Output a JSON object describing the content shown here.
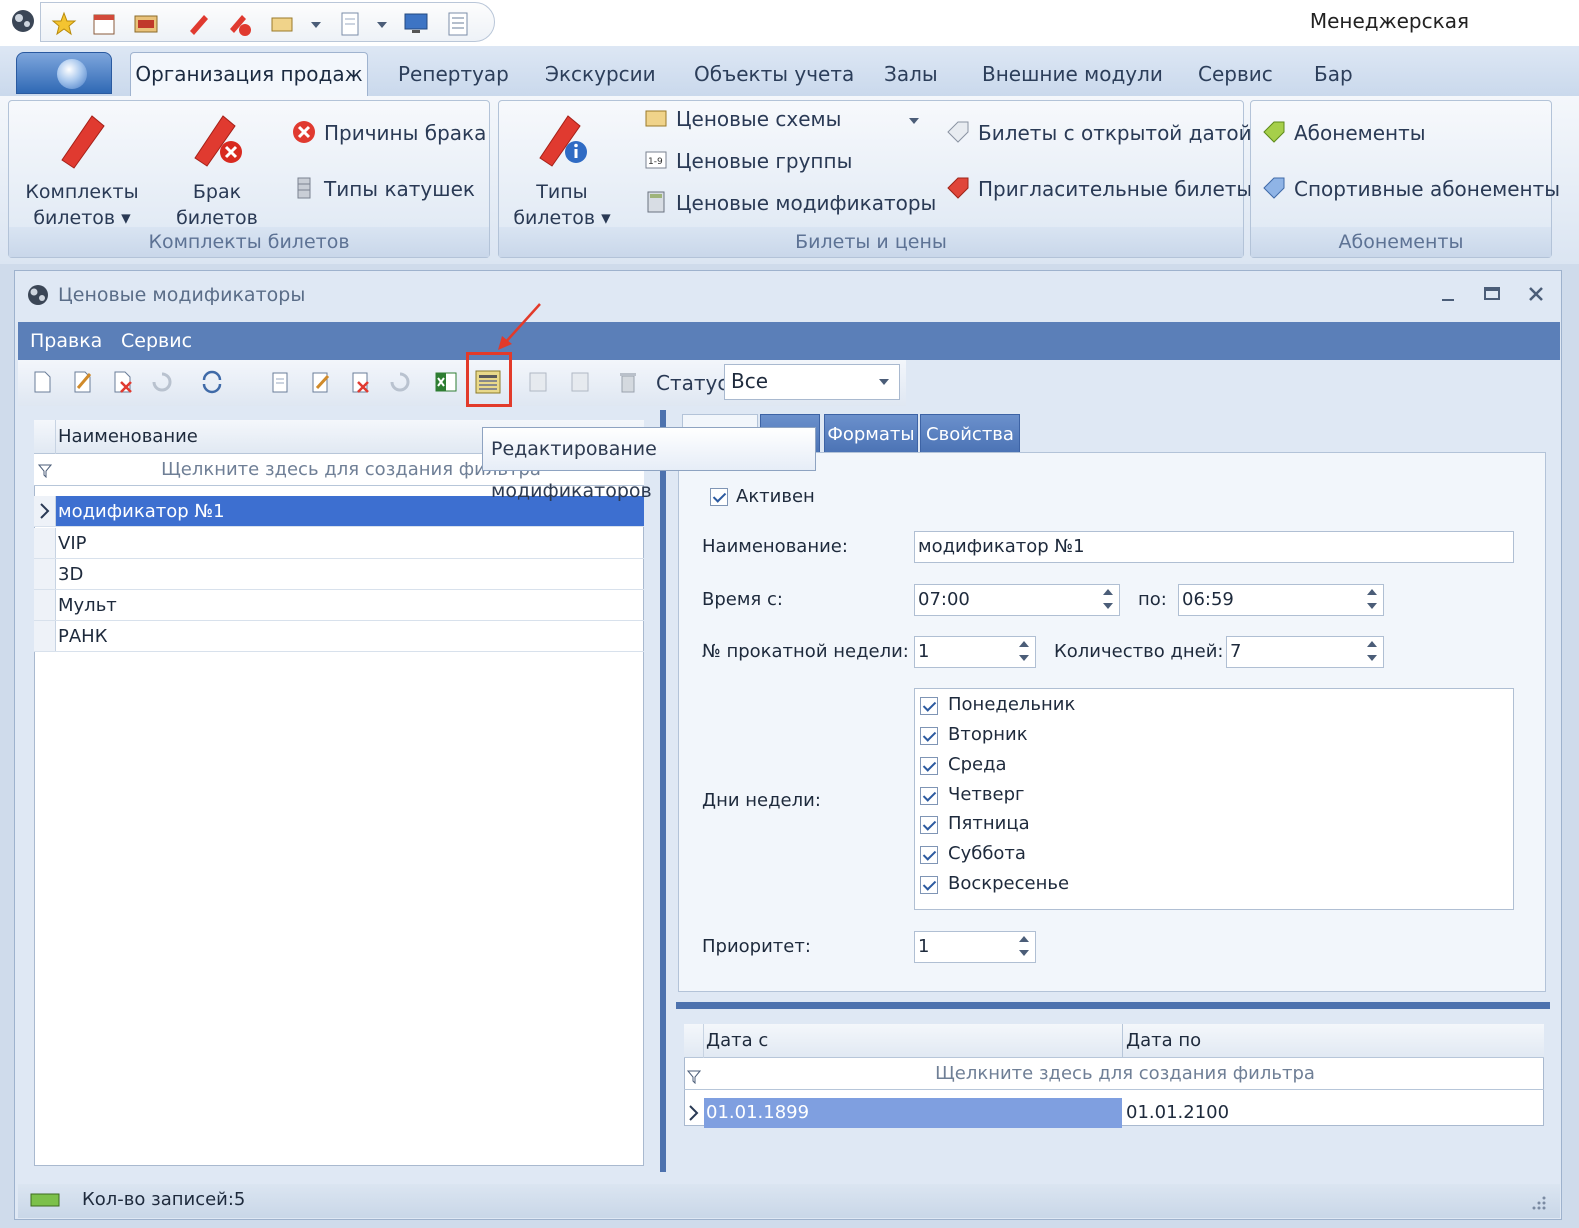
{
  "app_title": "Менеджерская",
  "ribbon_tabs": [
    "Организация продаж",
    "Репертуар",
    "Экскурсии",
    "Объекты учета",
    "Залы",
    "Внешние модули",
    "Сервис",
    "Бар"
  ],
  "groups": {
    "komplekty": {
      "label": "Комплекты билетов",
      "btn1": [
        "Комплекты",
        "билетов ▾"
      ],
      "btn2": [
        "Брак",
        "билетов"
      ],
      "small1": "Причины брака",
      "small2": "Типы катушек"
    },
    "bilety": {
      "label": "Билеты и цены",
      "btn1": [
        "Типы",
        "билетов ▾"
      ],
      "small1": "Ценовые схемы",
      "small2": "Ценовые группы",
      "small3": "Ценовые модификаторы",
      "small4": "Билеты с открытой датой",
      "small5": "Пригласительные билеты"
    },
    "abonementy": {
      "label": "Абонементы",
      "small1": "Абонементы",
      "small2": "Спортивные абонементы"
    }
  },
  "window": {
    "title": "Ценовые модификаторы",
    "menu": [
      "Правка",
      "Сервис"
    ],
    "status_label": "Статус",
    "status_value": "Все",
    "tooltip": "Редактирование модификаторов"
  },
  "list": {
    "header": "Наименование",
    "filter_hint": "Щелкните здесь для создания фильтра",
    "rows": [
      "модификатор №1",
      "VIP",
      "3D",
      "Мульт",
      "РАНК"
    ],
    "selected_index": 0
  },
  "tabs": [
    "Форматы",
    "Свойства"
  ],
  "form": {
    "active_label": "Активен",
    "name_label": "Наименование:",
    "name_value": "модификатор №1",
    "time_from_label": "Время с:",
    "time_from": "07:00",
    "time_to_label": "по:",
    "time_to": "06:59",
    "week_label": "№ прокатной недели:",
    "week_value": "1",
    "days_count_label": "Количество дней:",
    "days_count_value": "7",
    "weekdays_label": "Дни недели:",
    "weekdays": [
      "Понедельник",
      "Вторник",
      "Среда",
      "Четверг",
      "Пятница",
      "Суббота",
      "Воскресенье"
    ],
    "priority_label": "Приоритет:",
    "priority_value": "1"
  },
  "dates_grid": {
    "col1": "Дата с",
    "col2": "Дата по",
    "filter_hint": "Щелкните здесь для создания фильтра",
    "row": {
      "from": "01.01.1899",
      "to": "01.01.2100"
    }
  },
  "statusbar": {
    "records": "Кол-во записей:5"
  },
  "colors": {
    "accent": "#5b7fb8",
    "selection": "#3d6fd0",
    "highlight": "#e23a2a"
  }
}
